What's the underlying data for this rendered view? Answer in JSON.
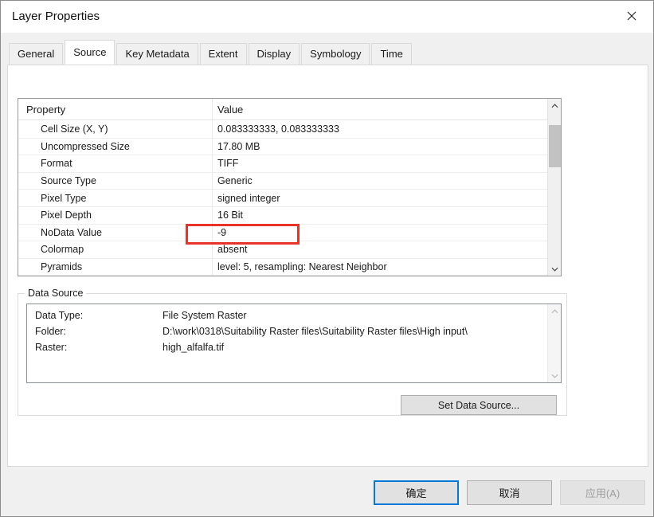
{
  "window": {
    "title": "Layer Properties"
  },
  "tabs": {
    "active": "Source",
    "items": [
      {
        "label": "General"
      },
      {
        "label": "Source"
      },
      {
        "label": "Key Metadata"
      },
      {
        "label": "Extent"
      },
      {
        "label": "Display"
      },
      {
        "label": "Symbology"
      },
      {
        "label": "Time"
      }
    ]
  },
  "property_table": {
    "columns": {
      "property": "Property",
      "value": "Value"
    },
    "rows": [
      {
        "property": "Cell Size (X, Y)",
        "value": "0.083333333, 0.083333333"
      },
      {
        "property": "Uncompressed Size",
        "value": "17.80 MB"
      },
      {
        "property": "Format",
        "value": "TIFF"
      },
      {
        "property": "Source Type",
        "value": "Generic"
      },
      {
        "property": "Pixel Type",
        "value": "signed integer"
      },
      {
        "property": "Pixel Depth",
        "value": "16 Bit"
      },
      {
        "property": "NoData Value",
        "value": "-9"
      },
      {
        "property": "Colormap",
        "value": "absent"
      },
      {
        "property": "Pyramids",
        "value": "level: 5, resampling: Nearest Neighbor"
      }
    ],
    "highlighted_value": "-9"
  },
  "data_source": {
    "legend": "Data Source",
    "fields": [
      {
        "label": "Data Type:",
        "value": "File System Raster"
      },
      {
        "label": "Folder:",
        "value": "D:\\work\\0318\\Suitability Raster files\\Suitability Raster files\\High input\\"
      },
      {
        "label": "Raster:",
        "value": "high_alfalfa.tif"
      }
    ],
    "set_button_label": "Set Data Source..."
  },
  "footer": {
    "ok_label": "确定",
    "cancel_label": "取消",
    "apply_label": "应用(A)"
  },
  "colors": {
    "accent_blue": "#0078d7",
    "highlight_red": "#e8332a",
    "button_face": "#e1e1e1"
  }
}
